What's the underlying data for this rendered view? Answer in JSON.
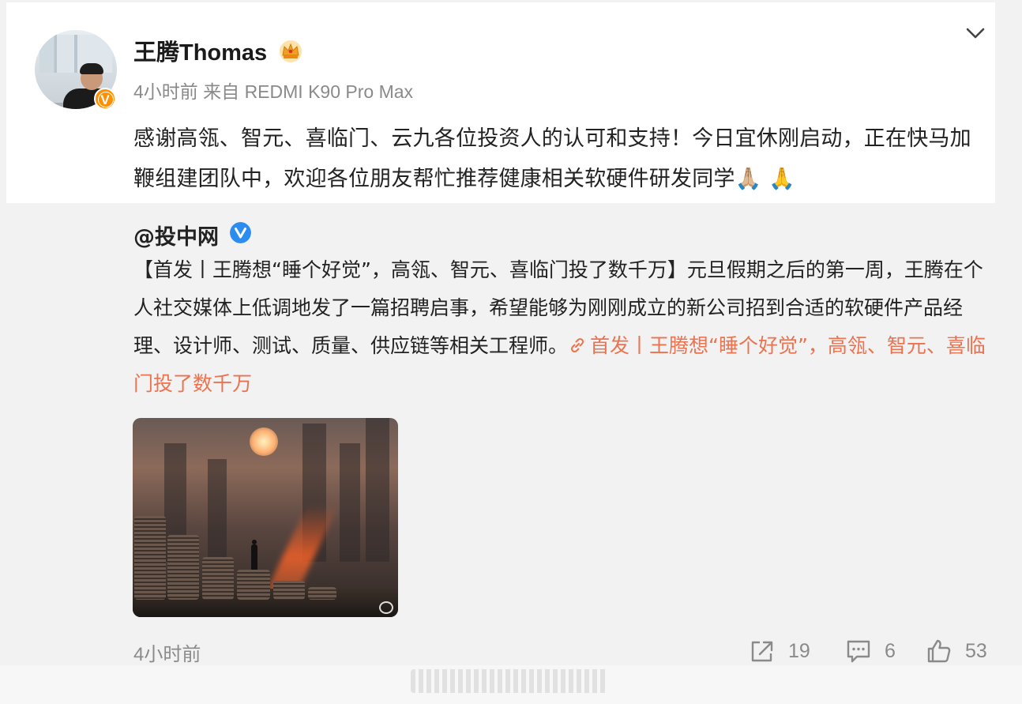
{
  "post": {
    "author": "王腾Thomas",
    "meta": "4小时前  来自 REDMI K90 Pro Max",
    "text": "感谢高瓴、智元、喜临门、云九各位投资人的认可和支持！今日宜休刚启动，正在快马加鞭组建团队中，欢迎各位朋友帮忙推荐健康相关软硬件研发同学🙏🏼 🙏"
  },
  "repost": {
    "author": "@投中网",
    "text": "【首发丨王腾想“睡个好觉”，高瓴、智元、喜临门投了数千万】元旦假期之后的第一周，王腾在个人社交媒体上低调地发了一篇招聘启事，希望能够为刚刚成立的新公司招到合适的软硬件产品经理、设计师、测试、质量、供应链等相关工程师。",
    "link_text": "首发丨王腾想“睡个好觉”，高瓴、智元、喜临门投了数千万",
    "link_color": "#eb7350"
  },
  "footer": {
    "time": "4小时前",
    "shares": "19",
    "comments": "6",
    "likes": "53"
  },
  "icons": {
    "badge_author": "orange-v-verified-icon",
    "crown": "crown-vip-icon",
    "menu": "chevron-down-icon",
    "badge_repost": "blue-v-verified-icon",
    "link": "link-icon",
    "share": "share-icon",
    "comment": "comment-icon",
    "like": "thumbs-up-icon"
  },
  "colors": {
    "accent_orange": "#ff8f00",
    "verified_blue": "#2d8cf0",
    "link_orange": "#eb7350",
    "muted_text": "#8a8a8a"
  }
}
